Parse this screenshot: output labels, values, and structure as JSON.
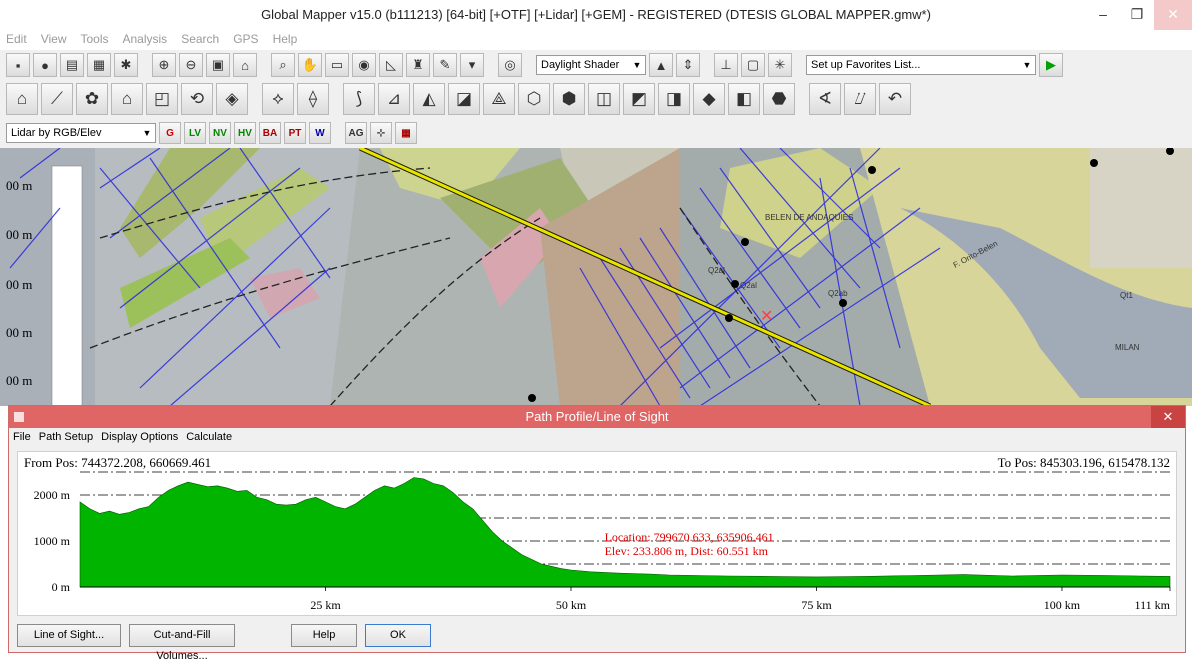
{
  "window": {
    "title": "Global Mapper v15.0 (b111213) [64-bit] [+OTF] [+Lidar] [+GEM] - REGISTERED (DTESIS GLOBAL MAPPER.gmw*)",
    "minimize": "–",
    "maximize": "❐",
    "close": "✕"
  },
  "menu": [
    "Edit",
    "View",
    "Tools",
    "Analysis",
    "Search",
    "GPS",
    "Help"
  ],
  "toolbar1": {
    "shader_select": "Daylight Shader",
    "favorites_select": "Set up Favorites List..."
  },
  "toolbar3": {
    "lidar_select": "Lidar by RGB/Elev",
    "lidar_buttons": [
      "G",
      "LV",
      "NV",
      "HV",
      "BA",
      "PT",
      "W",
      "AG"
    ]
  },
  "map": {
    "elevation_labels": [
      "00 m",
      "00 m",
      "00 m",
      "00 m",
      "00 m"
    ],
    "place_labels": [
      "BELEN DE ANDAQUIES",
      "F. Orito-Belen",
      "Q2al",
      "Qt1",
      "MILAN",
      "Q2ab",
      "Q2al"
    ]
  },
  "dialog": {
    "title": "Path Profile/Line of Sight",
    "close": "✕",
    "menu": [
      "File",
      "Path Setup",
      "Display Options",
      "Calculate"
    ],
    "from_pos": "From Pos: 744372.208, 660669.461",
    "to_pos": "To Pos: 845303.196, 615478.132",
    "cursor_location": "Location: 799670.633, 635906.461",
    "cursor_elev": "Elev: 233.806 m, Dist: 60.551 km",
    "buttons": {
      "line_of_sight": "Line of Sight...",
      "cut_fill": "Cut-and-Fill Volumes...",
      "help": "Help",
      "ok": "OK"
    }
  },
  "chart_data": {
    "type": "area",
    "x_unit": "km",
    "y_unit": "m",
    "xlim": [
      0,
      111
    ],
    "ylim": [
      0,
      2500
    ],
    "x_ticks": [
      "25 km",
      "50 km",
      "75 km",
      "100 km",
      "111 km"
    ],
    "x_tick_values": [
      25,
      50,
      75,
      100,
      111
    ],
    "y_ticks": [
      "0 m",
      "1000 m",
      "2000 m"
    ],
    "y_tick_values": [
      0,
      1000,
      2000
    ],
    "grid": "dash-dot horizontal at 500 m intervals",
    "fill_color": "#00b400",
    "profile_x": [
      0,
      1,
      2,
      3,
      4,
      5,
      6,
      7,
      8,
      9,
      10,
      11,
      12,
      13,
      14,
      15,
      16,
      17,
      18,
      19,
      20,
      21,
      22,
      23,
      24,
      25,
      26,
      27,
      28,
      29,
      30,
      31,
      32,
      33,
      34,
      35,
      36,
      37,
      38,
      39,
      40,
      41,
      42,
      43,
      44,
      45,
      46,
      47,
      48,
      49,
      50,
      52,
      55,
      58,
      60,
      63,
      66,
      70,
      75,
      80,
      85,
      90,
      95,
      100,
      105,
      108,
      111
    ],
    "profile_y": [
      1850,
      1700,
      1600,
      1650,
      1580,
      1620,
      1700,
      1750,
      1950,
      2100,
      2200,
      2280,
      2230,
      2180,
      2200,
      2150,
      2080,
      2100,
      1950,
      1900,
      1800,
      1780,
      1800,
      1900,
      1950,
      1850,
      1750,
      1700,
      1800,
      1950,
      2100,
      2200,
      2150,
      2250,
      2380,
      2350,
      2250,
      2200,
      2050,
      1850,
      1700,
      1450,
      1200,
      1000,
      850,
      700,
      600,
      500,
      450,
      400,
      370,
      330,
      300,
      280,
      260,
      250,
      240,
      230,
      220,
      230,
      250,
      270,
      240,
      260,
      250,
      240,
      230
    ],
    "cursor_x": 60.551
  }
}
